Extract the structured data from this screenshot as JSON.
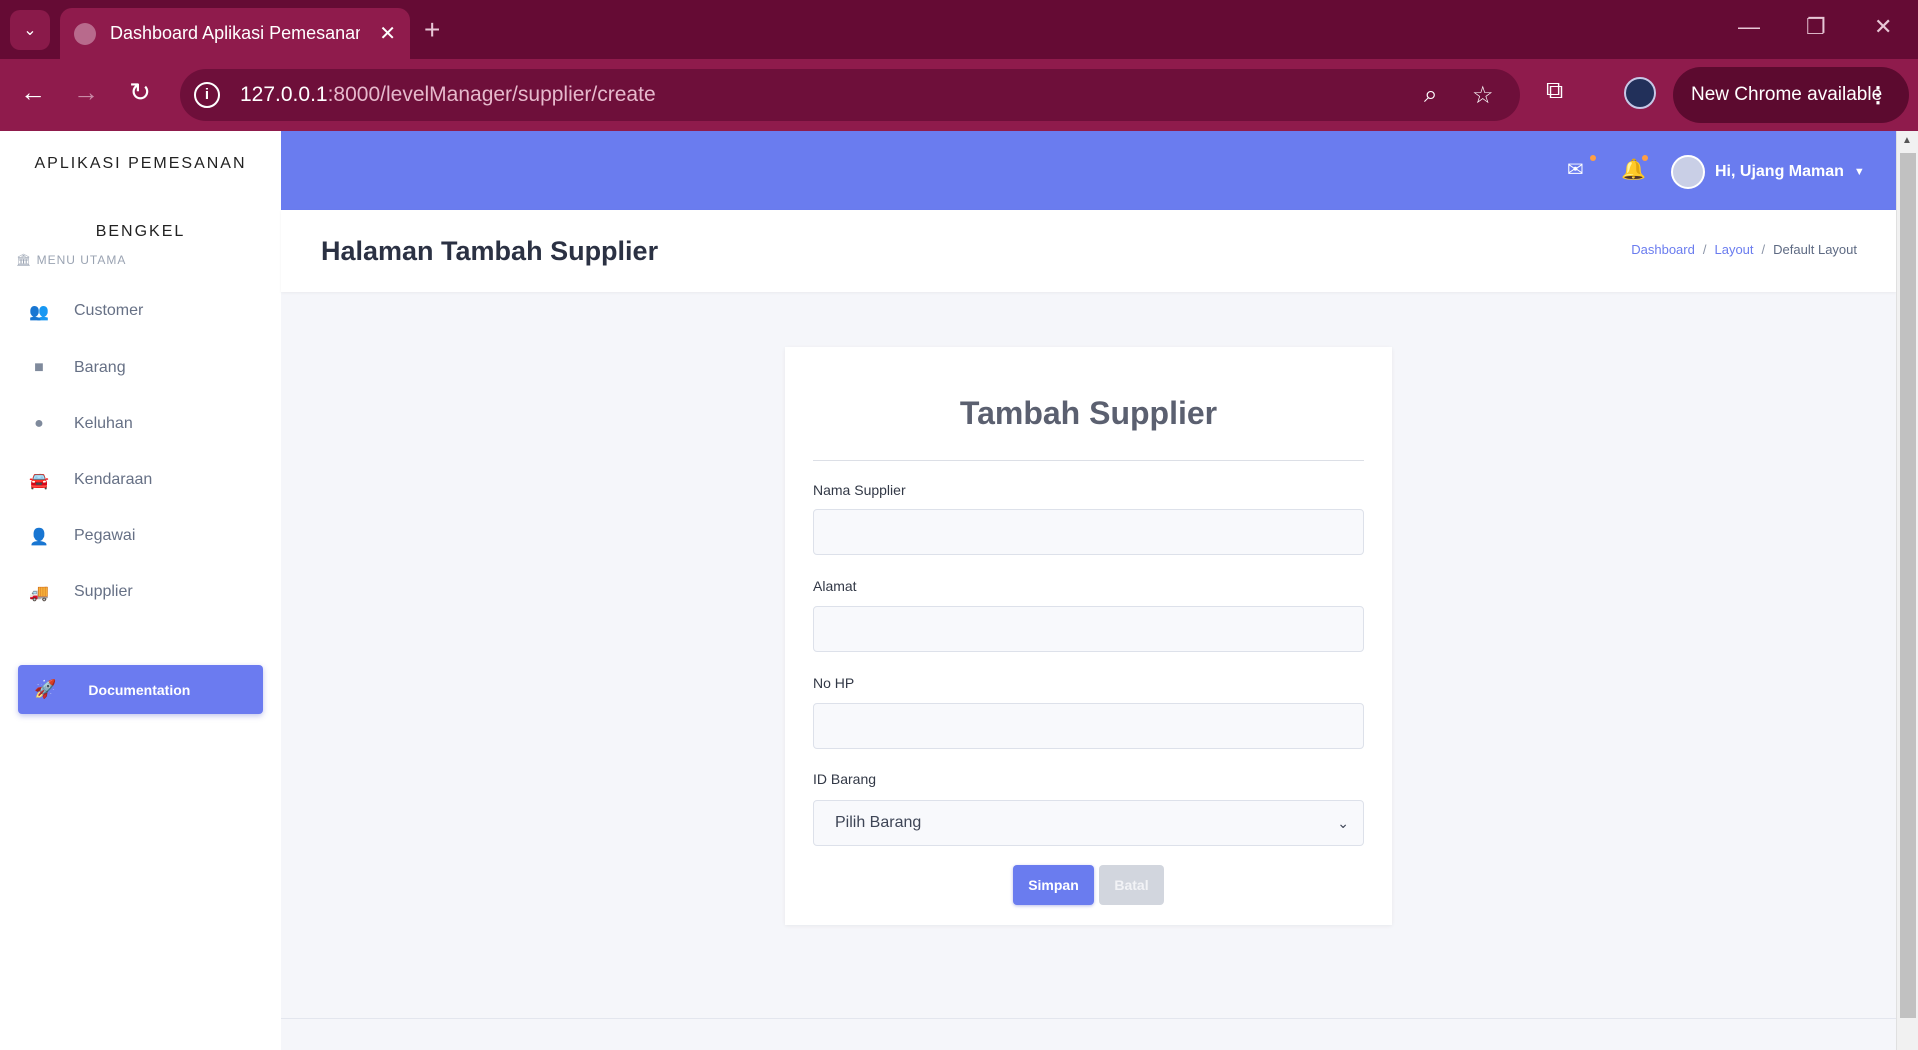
{
  "browser": {
    "tab_title": "Dashboard Aplikasi Pemesanan",
    "tab_close": "✕",
    "new_tab": "+",
    "url_host": "127.0.0.1",
    "url_path": ":8000/levelManager/supplier/create",
    "new_chrome": "New Chrome available"
  },
  "sidebar": {
    "brand_line1": "APLIKASI PEMESANAN",
    "brand_line2": "BENGKEL",
    "menu_heading": "MENU UTAMA",
    "items": [
      {
        "label": "Customer",
        "icon": "users-icon"
      },
      {
        "label": "Barang",
        "icon": "box-icon"
      },
      {
        "label": "Keluhan",
        "icon": "alert-icon"
      },
      {
        "label": "Kendaraan",
        "icon": "car-icon"
      },
      {
        "label": "Pegawai",
        "icon": "user-tie-icon"
      },
      {
        "label": "Supplier",
        "icon": "truck-icon"
      }
    ],
    "doc_button": "Documentation"
  },
  "topbar": {
    "user_greeting": "Hi, Ujang Maman"
  },
  "page": {
    "title": "Halaman Tambah Supplier",
    "breadcrumb": [
      "Dashboard",
      "Layout",
      "Default Layout"
    ]
  },
  "form": {
    "title": "Tambah Supplier",
    "fields": [
      {
        "label": "Nama Supplier",
        "value": ""
      },
      {
        "label": "Alamat",
        "value": ""
      },
      {
        "label": "No HP",
        "value": ""
      }
    ],
    "select_label": "ID Barang",
    "select_value": "Pilih Barang",
    "save_label": "Simpan",
    "cancel_label": "Batal"
  },
  "colors": {
    "accent": "#6a7cef",
    "browser_frame": "#8f1b4c"
  }
}
